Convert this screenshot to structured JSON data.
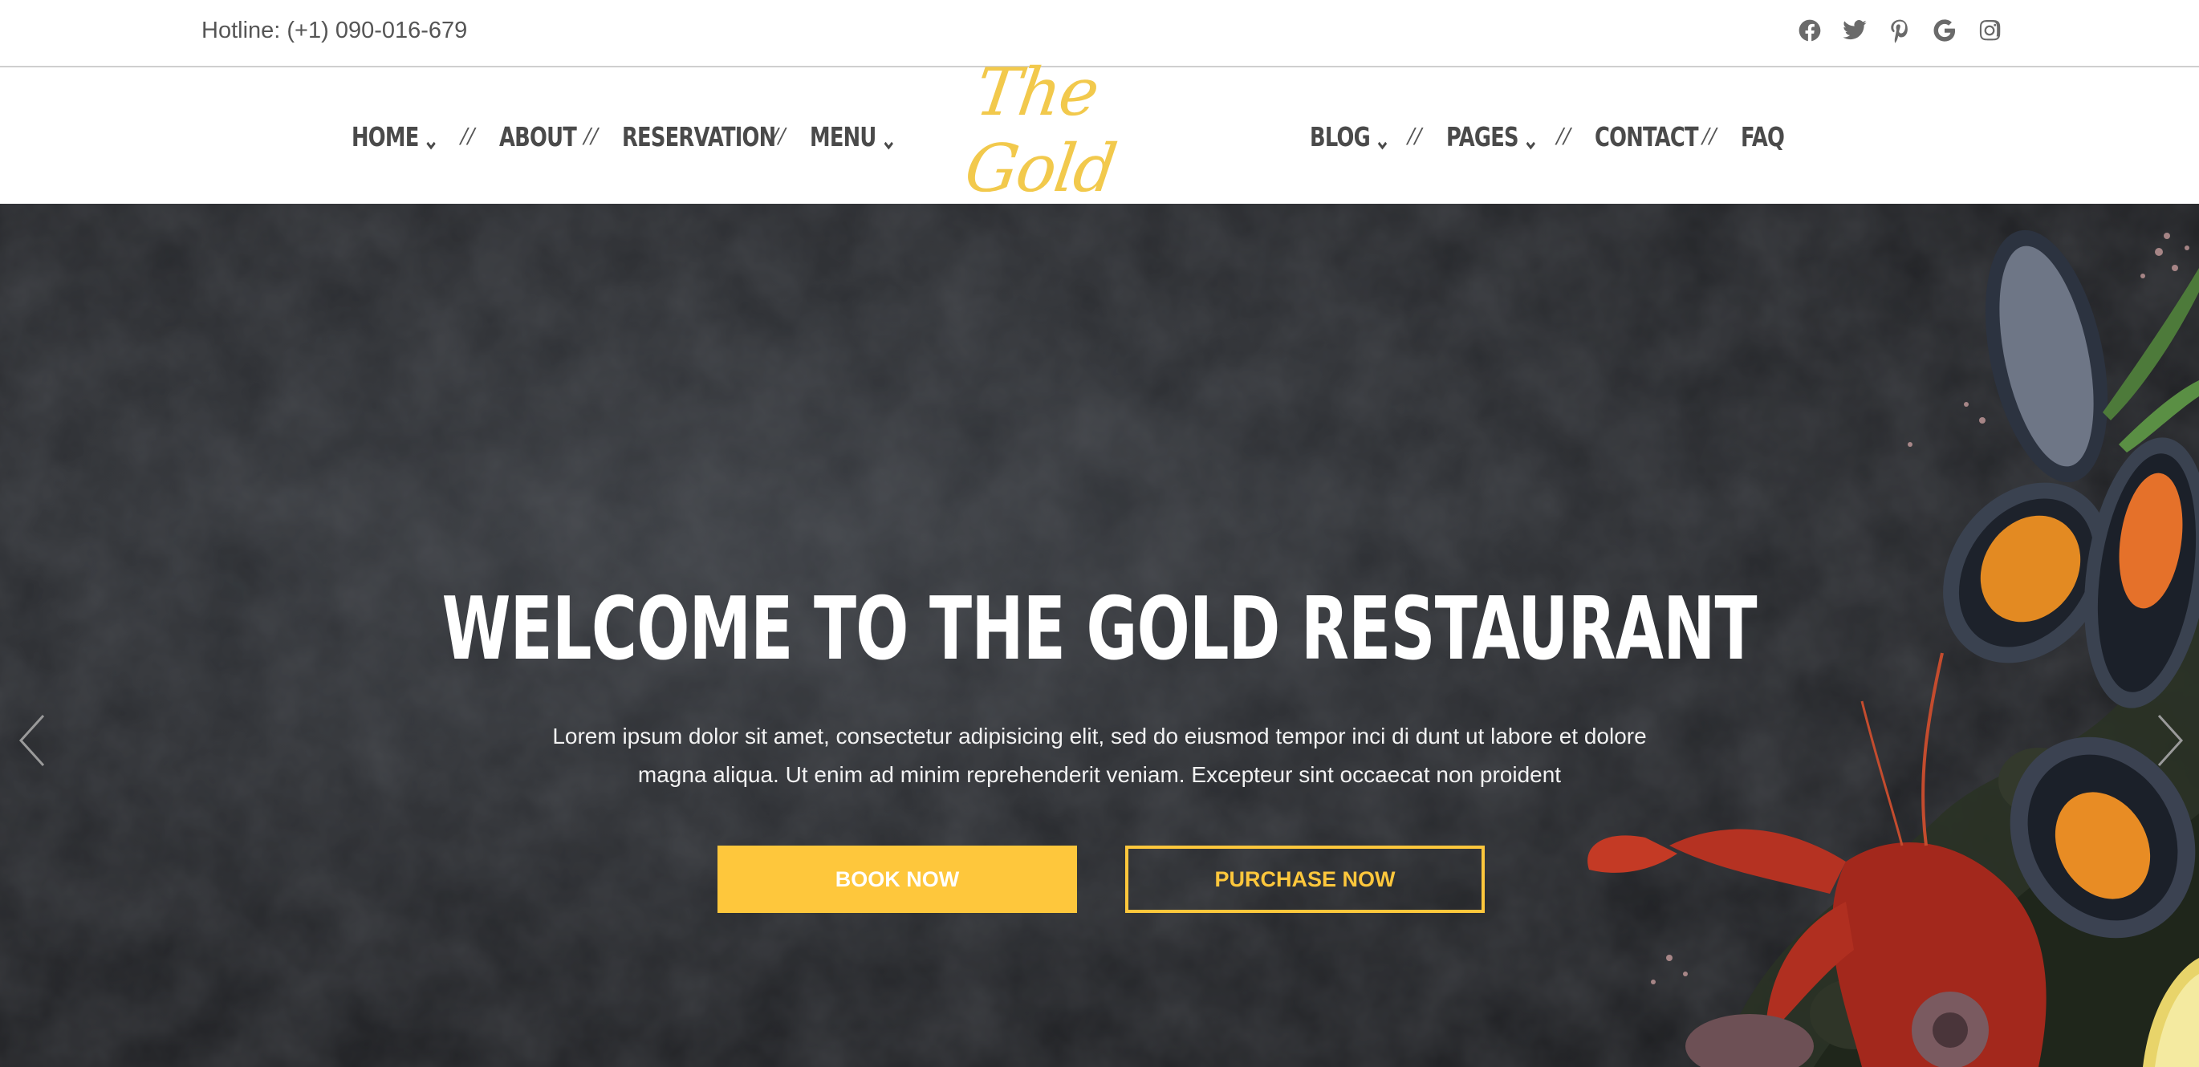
{
  "topbar": {
    "hotline": "Hotline: (+1) 090-016-679",
    "socials": [
      "facebook-icon",
      "twitter-icon",
      "pinterest-icon",
      "google-icon",
      "instagram-icon"
    ]
  },
  "nav": {
    "left": [
      {
        "label": "HOME",
        "dropdown": true
      },
      {
        "label": "ABOUT",
        "dropdown": false
      },
      {
        "label": "RESERVATION",
        "dropdown": false
      },
      {
        "label": "MENU",
        "dropdown": true
      }
    ],
    "right": [
      {
        "label": "BLOG",
        "dropdown": true
      },
      {
        "label": "PAGES",
        "dropdown": true
      },
      {
        "label": "CONTACT",
        "dropdown": false
      },
      {
        "label": "FAQ",
        "dropdown": false
      }
    ],
    "separator": "//"
  },
  "logo": {
    "text": "The Gold"
  },
  "hero": {
    "title": "WELCOME TO THE GOLD RESTAURANT",
    "text_line1": "Lorem ipsum dolor sit amet, consectetur adipisicing elit, sed do eiusmod tempor inci di dunt ut labore et dolore",
    "text_line2": "magna aliqua. Ut enim ad minim reprehenderit veniam. Excepteur sint occaecat non proident",
    "book_label": "BOOK NOW",
    "purchase_label": "PURCHASE NOW"
  },
  "colors": {
    "accent": "#fec73c",
    "nav_text": "#4a4a4a",
    "hero_bg": "#2b2d31"
  }
}
